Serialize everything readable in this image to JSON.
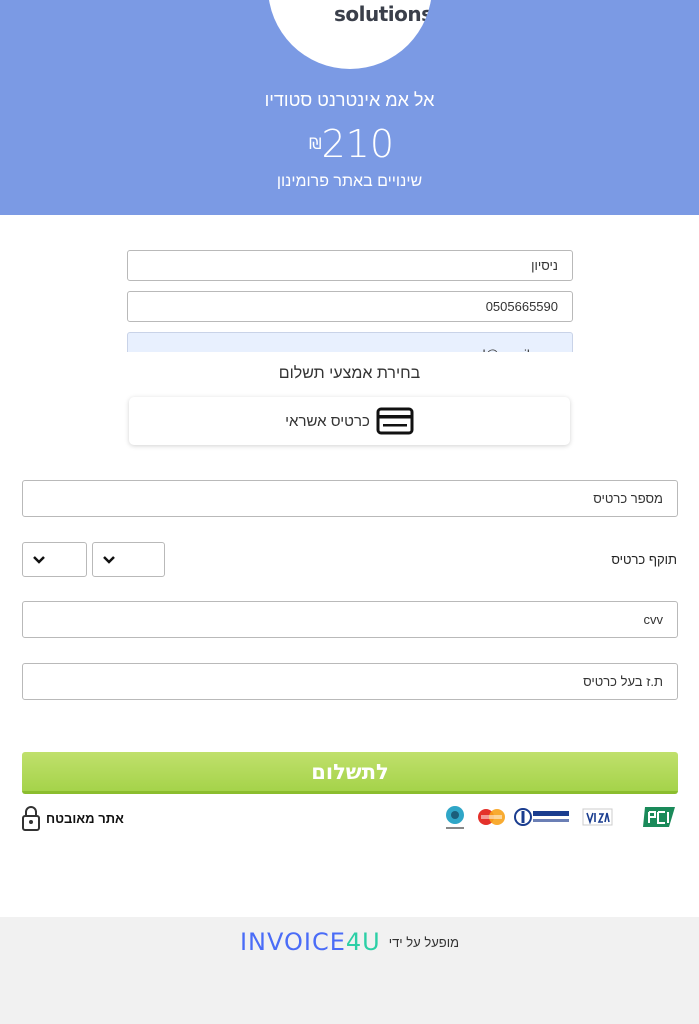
{
  "header": {
    "logo_text": "solutions",
    "merchant_name": "אל אמ אינטרנט סטודיו",
    "amount": "210",
    "currency": "₪",
    "description": "שינויים באתר פרומינון"
  },
  "customer": {
    "name_value": "ניסיון",
    "phone_value": "0505665590",
    "email_value": "mr.rempel@gmail.com"
  },
  "payment_methods": {
    "title": "בחירת אמצעי תשלום",
    "selected_label": "כרטיס אשראי",
    "selected_icon": "credit-card-icon"
  },
  "card_form": {
    "card_number_placeholder": "מספר כרטיס",
    "expiry_label": "תוקף כרטיס",
    "cvv_placeholder": "cvv",
    "id_placeholder": "ת.ז בעל כרטיס"
  },
  "pay_button_label": "לתשלום",
  "secure_site_label": "אתר מאובטח",
  "card_logos": [
    "pci-icon",
    "visa-icon",
    "diners-club-icon",
    "mastercard-icon",
    "isracard-icon"
  ],
  "footer": {
    "powered_by": "מופעל על ידי",
    "brand_part1": "INVOICE",
    "brand_part2": "4U"
  },
  "colors": {
    "header_bg": "#7b9ae4",
    "pay_button": "#a5d34a",
    "footer_bg": "#f1f1f1"
  }
}
